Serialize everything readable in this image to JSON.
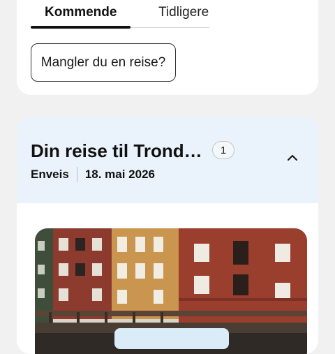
{
  "tabs": {
    "active_label": "Kommende",
    "inactive_label": "Tidligere"
  },
  "missing_trip_button": "Mangler du en reise?",
  "trip": {
    "title": "Din reise til Trond…",
    "count": "1",
    "type": "Enveis",
    "date": "18. mai 2026",
    "toggle_icon": "chevron-up-icon",
    "image_subject": "trondheim-wharf-photo"
  },
  "colors": {
    "page_background": "#f1f1f1",
    "card_background": "#ffffff",
    "header_background": "#eaf2fb",
    "tab_active_underline": "#111111"
  }
}
